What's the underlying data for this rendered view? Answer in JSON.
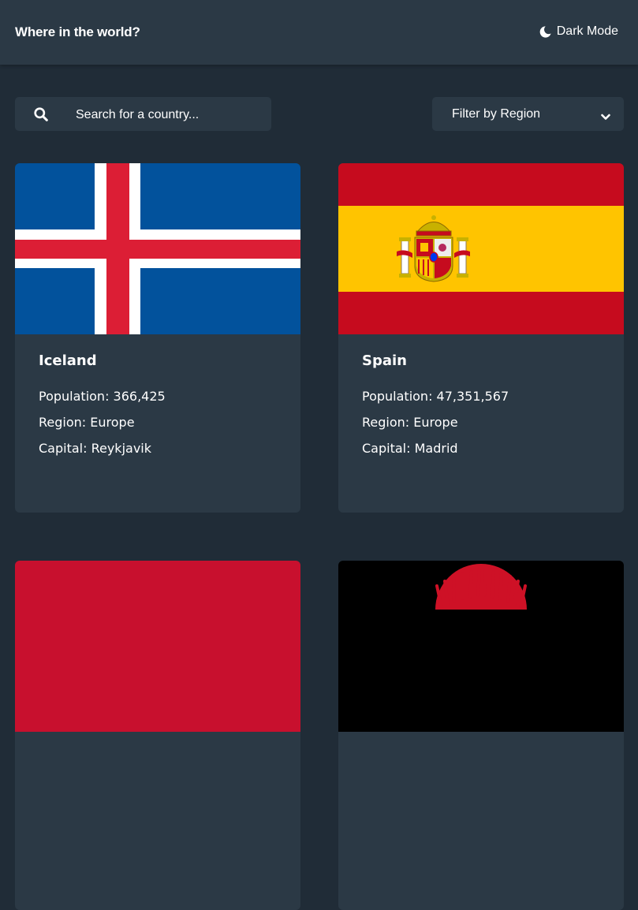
{
  "header": {
    "title": "Where in the world?",
    "dark_mode_label": "Dark Mode"
  },
  "search": {
    "placeholder": "Search for a country..."
  },
  "filter": {
    "label": "Filter by Region"
  },
  "labels": {
    "population": "Population:",
    "region": "Region:",
    "capital": "Capital:"
  },
  "countries": [
    {
      "name": "Iceland",
      "population": "366,425",
      "region": "Europe",
      "capital": "Reykjavik",
      "flag": "iceland-flag"
    },
    {
      "name": "Spain",
      "population": "47,351,567",
      "region": "Europe",
      "capital": "Madrid",
      "flag": "spain-flag"
    },
    {
      "flag": "red-flag"
    },
    {
      "flag": "malawi-flag"
    }
  ],
  "colors": {
    "background": "#202c37",
    "element": "#2b3945",
    "text": "#ffffff"
  }
}
